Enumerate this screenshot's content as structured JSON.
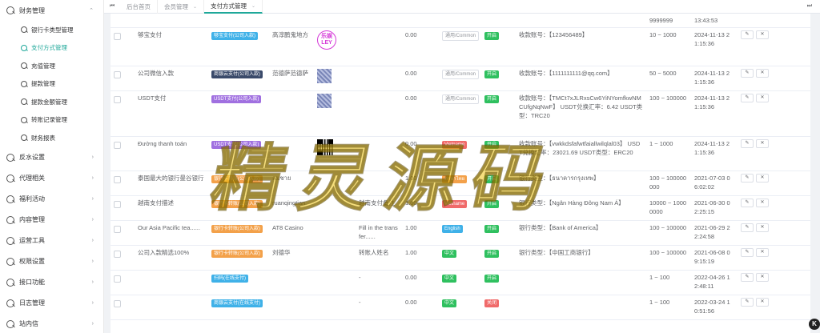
{
  "sidebar": {
    "groups": [
      {
        "label": "财务管理",
        "open": true
      },
      {
        "label": "反水设置"
      },
      {
        "label": "代理相关"
      },
      {
        "label": "福利活动"
      },
      {
        "label": "内容管理"
      },
      {
        "label": "运营工具"
      },
      {
        "label": "权限设置"
      },
      {
        "label": "接口功能"
      },
      {
        "label": "日志管理"
      },
      {
        "label": "站内信"
      }
    ],
    "finance_items": [
      {
        "label": "银行卡类型管理"
      },
      {
        "label": "支付方式管理",
        "active": true
      },
      {
        "label": "充值管理"
      },
      {
        "label": "提款管理"
      },
      {
        "label": "提款金额管理"
      },
      {
        "label": "转账记录管理"
      },
      {
        "label": "财务报表"
      }
    ],
    "chevron_up": "⌃",
    "chevron_right": "›"
  },
  "tabs": {
    "prev": "⏮",
    "next": "⏭",
    "items": [
      {
        "label": "后台首页",
        "closable": false
      },
      {
        "label": "会员管理",
        "closable": true
      },
      {
        "label": "支付方式管理",
        "closable": true,
        "active": true
      }
    ],
    "close_glyph": "⌄"
  },
  "table": {
    "top_partial": {
      "range": "9999999",
      "time": "13:43:53"
    },
    "rows": [
      {
        "name": "够宝支付",
        "type": "够宝支付(公司入款)",
        "type_color": "blue",
        "holder": "高淳鹏鬼地方",
        "image": "logo",
        "note": "",
        "fee": "0.00",
        "lang": "通用/Common",
        "lang_style": "grey",
        "status": "开启",
        "status_color": "green",
        "info": "收款账号：【123456489】",
        "range": "10 ~ 1000",
        "time": "2024-11-13 21:15:36"
      },
      {
        "name": "公司微信入款",
        "type": "商银云支付(公司入款)",
        "type_color": "dark",
        "holder": "范德萨范德萨",
        "image": "thumb",
        "note": "",
        "fee": "0.00",
        "lang": "通用/Common",
        "lang_style": "grey",
        "status": "开启",
        "status_color": "green",
        "info": "收款账号：【1111111111@qq.com】",
        "range": "50 ~ 5000",
        "time": "2024-11-13 21:15:36"
      },
      {
        "name": "USDT支付",
        "type": "USDT支付(公司入款)",
        "type_color": "purple",
        "holder": "",
        "image": "thumb",
        "note": "",
        "fee": "0.00",
        "lang": "通用/Common",
        "lang_style": "grey",
        "status": "开启",
        "status_color": "green",
        "info": "收款账号：【TMCt7xJLRxsCw6YiNYomfkwNMCUfgNqNwF】 USDT兑换汇率：6.42 USDT类型：TRC20",
        "range": "100 ~ 100000",
        "time": "2024-11-13 21:15:36"
      },
      {
        "name": "Đường thanh toán",
        "type": "USDT支付(公司入款)",
        "type_color": "purple",
        "holder": "",
        "image": "qr",
        "note": "",
        "fee": "0.00",
        "lang": "Vietname",
        "lang_style": "red",
        "status": "开启",
        "status_color": "green",
        "info": "收款账号：【vwkkdsfafwtfaiallwilqlal03】 USDT兑换汇率：23021.69 USDT类型：ERC20",
        "range": "1 ~ 1000",
        "time": "2024-11-13 21:15:36"
      },
      {
        "name": "泰国最大的银行曼谷银行",
        "type": "银行卡转账(公司入款)",
        "type_color": "orange",
        "holder": "สมชาย",
        "image": "",
        "note": "-",
        "fee": "1.00",
        "lang": "ภาษาไทย",
        "lang_style": "orange",
        "status": "开启",
        "status_color": "green",
        "info": "银行类型：【ธนาคารกรุงเทพ】",
        "range": "100 ~ 100000000",
        "time": "2021-07-03 06:02:02"
      },
      {
        "name": "越南支付描述",
        "type": "银行卡转账(公司入款)",
        "type_color": "orange",
        "holder": "ruanqingtian",
        "image": "",
        "note": "越南支付备注",
        "fee": "1.00",
        "lang": "Vietname",
        "lang_style": "red",
        "status": "开启",
        "status_color": "green",
        "info": "银行类型：【Ngân Hàng Đông Nam Á】",
        "range": "10000 ~ 10000000",
        "time": "2021-06-30 02:25:15"
      },
      {
        "name": "Our Asia Pacific tea......",
        "type": "银行卡转账(公司入款)",
        "type_color": "orange",
        "holder": "AT8 Casino",
        "image": "",
        "note": "Fill in the transfer......",
        "fee": "1.00",
        "lang": "English",
        "lang_style": "blue",
        "status": "开启",
        "status_color": "green",
        "info": "银行类型：【Bank of America】",
        "range": "100 ~ 100000",
        "time": "2021-06-29 22:24:58"
      },
      {
        "name": "公司入款精选100%",
        "type": "银行卡转账(公司入款)",
        "type_color": "orange",
        "holder": "刘德华",
        "image": "",
        "note": "转账人姓名",
        "fee": "1.00",
        "lang": "中文",
        "lang_style": "green",
        "status": "开启",
        "status_color": "green",
        "info": "银行类型：【中国工商银行】",
        "range": "100 ~ 100000",
        "time": "2021-06-08 09:15:19"
      },
      {
        "name": "",
        "type": "扫码(在线支付)",
        "type_color": "blue",
        "holder": "",
        "image": "",
        "note": "-",
        "fee": "0.00",
        "lang": "中文",
        "lang_style": "green",
        "status": "开启",
        "status_color": "green",
        "info": "",
        "range": "1 ~ 100",
        "time": "2022-04-26 12:48:11"
      },
      {
        "name": "",
        "type": "商银云支付(在线支付)",
        "type_color": "blue",
        "holder": "",
        "image": "",
        "note": "-",
        "fee": "0.00",
        "lang": "中文",
        "lang_style": "green",
        "status": "关闭",
        "status_color": "red",
        "info": "",
        "range": "1 ~ 100",
        "time": "2022-03-24 10:51:56"
      }
    ],
    "edit_glyph": "✎",
    "delete_glyph": "✕"
  },
  "image_logo": {
    "line1": "乐娱",
    "line2": "LEY"
  },
  "watermark": "精灵源码",
  "help_badge": "K"
}
